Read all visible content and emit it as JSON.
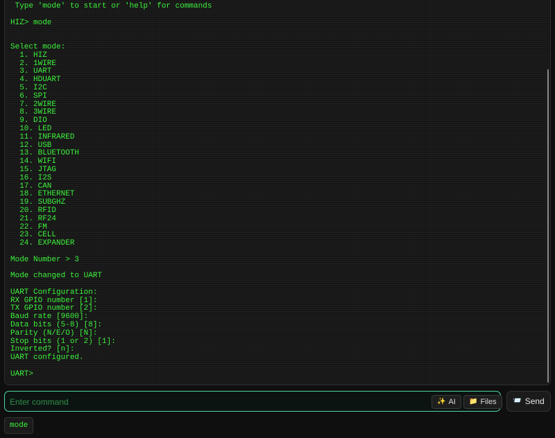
{
  "terminal": {
    "lines": [
      " Type 'mode' to start or 'help' for commands",
      "",
      "HIZ> mode",
      "",
      "",
      "Select mode:",
      "  1. HIZ",
      "  2. 1WIRE",
      "  3. UART",
      "  4. HDUART",
      "  5. I2C",
      "  6. SPI",
      "  7. 2WIRE",
      "  8. 3WIRE",
      "  9. DIO",
      "  10. LED",
      "  11. INFRARED",
      "  12. USB",
      "  13. BLUETOOTH",
      "  14. WIFI",
      "  15. JTAG",
      "  16. I2S",
      "  17. CAN",
      "  18. ETHERNET",
      "  19. SUBGHZ",
      "  20. RFID",
      "  21. RF24",
      "  22. FM",
      "  23. CELL",
      "  24. EXPANDER",
      "",
      "Mode Number > 3",
      "",
      "Mode changed to UART",
      "",
      "UART Configuration:",
      "RX GPIO number [1]:",
      "TX GPIO number [2]:",
      "Baud rate [9600]:",
      "Data bits (5-8) [8]:",
      "Parity (N/E/O) [N]:",
      "Stop bits (1 or 2) [1]:",
      "Inverted? [n]:",
      "UART configured.",
      "",
      "UART>"
    ]
  },
  "command_bar": {
    "placeholder": "Enter command",
    "ai_label": "AI",
    "files_label": "Files",
    "ai_icon_glyph": "✨",
    "files_icon_glyph": "📁"
  },
  "send": {
    "label": "Send",
    "icon_glyph": "📨"
  },
  "history": {
    "chips": [
      "mode"
    ]
  },
  "colors": {
    "terminal_text": "#3cf23c",
    "input_border": "#4fd9a0",
    "background": "#0f0f0f"
  }
}
